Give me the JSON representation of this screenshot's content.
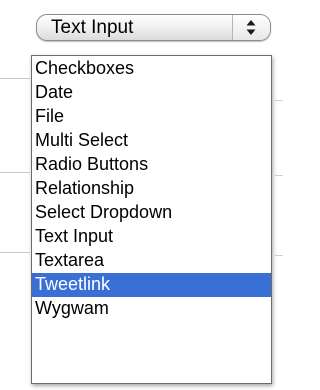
{
  "select": {
    "value": "Text Input",
    "selected_option": "Tweetlink"
  },
  "options": [
    {
      "label": "Checkboxes"
    },
    {
      "label": "Date"
    },
    {
      "label": "File"
    },
    {
      "label": "Multi Select"
    },
    {
      "label": "Radio Buttons"
    },
    {
      "label": "Relationship"
    },
    {
      "label": "Select Dropdown"
    },
    {
      "label": "Text Input"
    },
    {
      "label": "Textarea"
    },
    {
      "label": "Tweetlink",
      "selected": true
    },
    {
      "label": "Wygwam"
    }
  ],
  "icons": {
    "stepper": "up-down-arrows-icon"
  },
  "colors": {
    "highlight": "#3a6fd6",
    "highlight_text": "#ffffff",
    "text": "#000000",
    "border": "#8c8c8c"
  }
}
